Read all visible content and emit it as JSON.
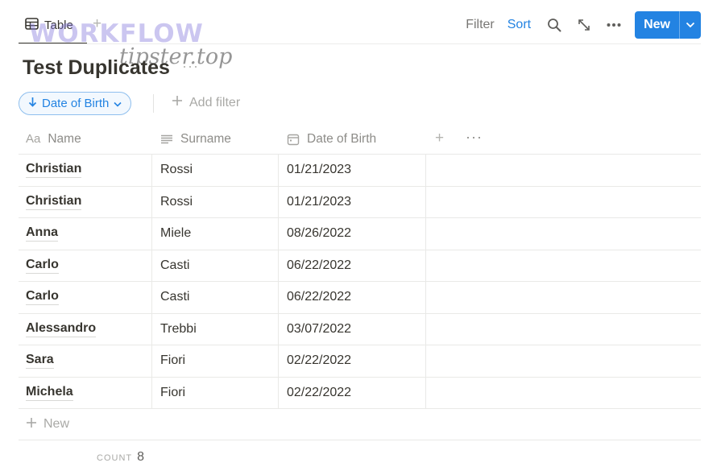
{
  "toolbar": {
    "view_tab_label": "Table",
    "add_view": "+",
    "filter_label": "Filter",
    "sort_label": "Sort",
    "more": "···",
    "new_label": "New",
    "accent_color": "#2383e2"
  },
  "watermark": {
    "top": "WORKFLOW",
    "bottom": "tipster.top"
  },
  "page": {
    "title": "Test Duplicates",
    "title_more": "···"
  },
  "filters": {
    "sort_chip_label": "Date of Birth",
    "add_filter_label": "Add filter"
  },
  "table": {
    "columns": [
      {
        "label": "Name",
        "icon": "Aa",
        "icon_name": "title-property-icon"
      },
      {
        "label": "Surname",
        "icon_name": "text-property-icon"
      },
      {
        "label": "Date of Birth",
        "icon_name": "calendar-property-icon"
      }
    ],
    "add_column": "+",
    "column_more": "···",
    "rows": [
      {
        "name": "Christian",
        "surname": "Rossi",
        "dob": "01/21/2023"
      },
      {
        "name": "Christian",
        "surname": "Rossi",
        "dob": "01/21/2023"
      },
      {
        "name": "Anna",
        "surname": "Miele",
        "dob": "08/26/2022"
      },
      {
        "name": "Carlo",
        "surname": "Casti",
        "dob": "06/22/2022"
      },
      {
        "name": "Carlo",
        "surname": "Casti",
        "dob": "06/22/2022"
      },
      {
        "name": "Alessandro",
        "surname": "Trebbi",
        "dob": "03/07/2022"
      },
      {
        "name": "Sara",
        "surname": "Fiori",
        "dob": "02/22/2022"
      },
      {
        "name": "Michela",
        "surname": "Fiori",
        "dob": "02/22/2022"
      }
    ],
    "new_row_label": "New"
  },
  "footer": {
    "count_label": "COUNT",
    "count_value": "8"
  }
}
